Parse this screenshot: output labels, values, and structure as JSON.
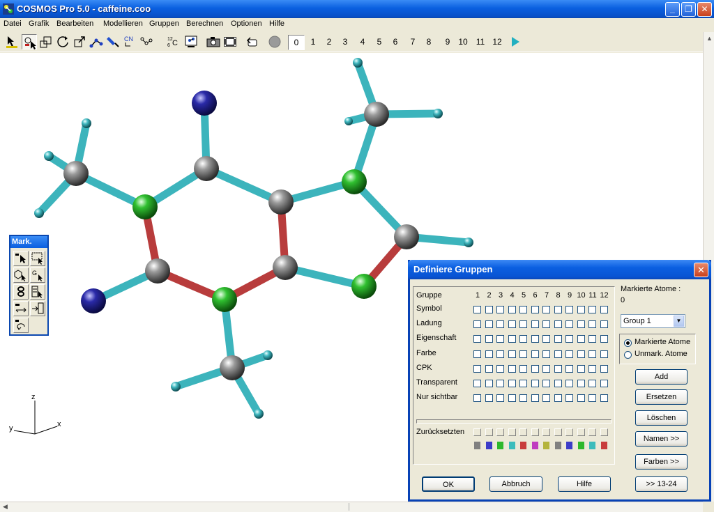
{
  "window": {
    "title": "COSMOS Pro 5.0 - caffeine.coo",
    "minimize": "_",
    "maximize": "❐",
    "close": "✕"
  },
  "menu": [
    "Datei",
    "Grafik",
    "Bearbeiten",
    "Modellieren",
    "Gruppen",
    "Berechnen",
    "Optionen",
    "Hilfe"
  ],
  "toolbar": {
    "label_12c": "12C",
    "label_cn": "CN",
    "numbers": [
      "0",
      "1",
      "2",
      "3",
      "4",
      "5",
      "6",
      "7",
      "8",
      "9",
      "10",
      "11",
      "12"
    ],
    "selected_number": "0"
  },
  "axes": {
    "z": "z",
    "y": "y",
    "x": "x"
  },
  "mark_palette": {
    "title": "Mark.",
    "g_label": "G"
  },
  "dialog": {
    "title": "Definiere Gruppen",
    "close": "✕",
    "gruppe_header": "Gruppe",
    "columns": [
      "1",
      "2",
      "3",
      "4",
      "5",
      "6",
      "7",
      "8",
      "9",
      "10",
      "11",
      "12"
    ],
    "rows": [
      "Symbol",
      "Ladung",
      "Eigenschaft",
      "Farbe",
      "CPK",
      "Transparent",
      "Nur sichtbar"
    ],
    "reset_label": "Zurücksetzten",
    "swatch_colors": [
      "#808080",
      "#3c3cc8",
      "#2db82d",
      "#3cbcbc",
      "#c83c3c",
      "#c03cc0",
      "#b4b43c",
      "#808080",
      "#3c3cc8",
      "#2db82d",
      "#3cbcbc",
      "#c83c3c"
    ],
    "marked_atoms_label": "Markierte Atome :",
    "marked_atoms_value": "0",
    "group_select": "Group 1",
    "radio_marked": "Markierte Atome",
    "radio_unmarked": "Unmark. Atome",
    "btn_add": "Add",
    "btn_replace": "Ersetzen",
    "btn_delete": "Löschen",
    "btn_names": "Namen >>",
    "btn_colors": "Farben >>",
    "btn_ok": "OK",
    "btn_cancel": "Abbruch",
    "btn_help": "Hilfe",
    "btn_more": ">> 13-24"
  }
}
